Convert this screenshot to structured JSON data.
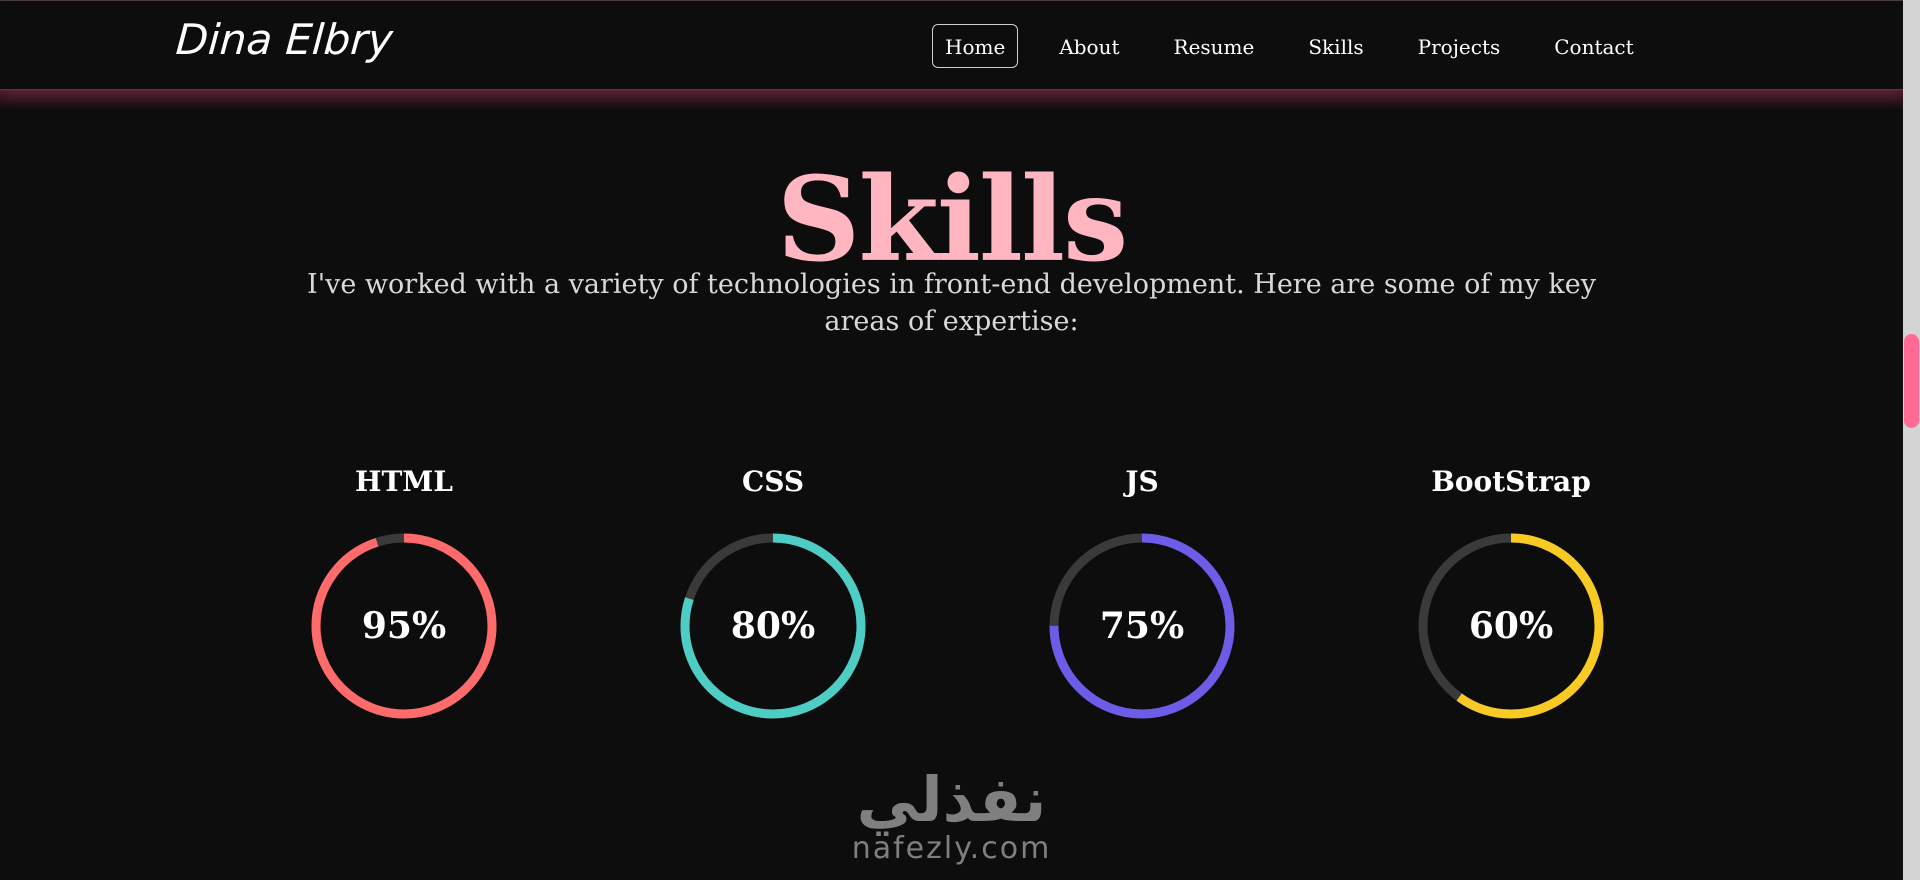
{
  "brand": "Dina Elbry",
  "nav": {
    "items": [
      {
        "label": "Home",
        "active": true
      },
      {
        "label": "About",
        "active": false
      },
      {
        "label": "Resume",
        "active": false
      },
      {
        "label": "Skills",
        "active": false
      },
      {
        "label": "Projects",
        "active": false
      },
      {
        "label": "Contact",
        "active": false
      }
    ]
  },
  "skills": {
    "title": "Skills",
    "subtitle": "I've worked with a variety of technologies in front-end development. Here are some of my key areas of expertise:",
    "items": [
      {
        "name": "HTML",
        "percent": 95,
        "label": "95%",
        "color": "#ff6b6b"
      },
      {
        "name": "CSS",
        "percent": 80,
        "label": "80%",
        "color": "#4ecdc4"
      },
      {
        "name": "JS",
        "percent": 75,
        "label": "75%",
        "color": "#6c5ce7"
      },
      {
        "name": "BootStrap",
        "percent": 60,
        "label": "60%",
        "color": "#f9ca24"
      }
    ],
    "track_color": "#3a3a3a"
  },
  "watermark": {
    "arabic": "نفذلي",
    "latin": "nafezly.com"
  },
  "colors": {
    "background": "#0d0d0e",
    "title_pink": "#ffb6c1",
    "accent_pink": "#ff6b94"
  }
}
